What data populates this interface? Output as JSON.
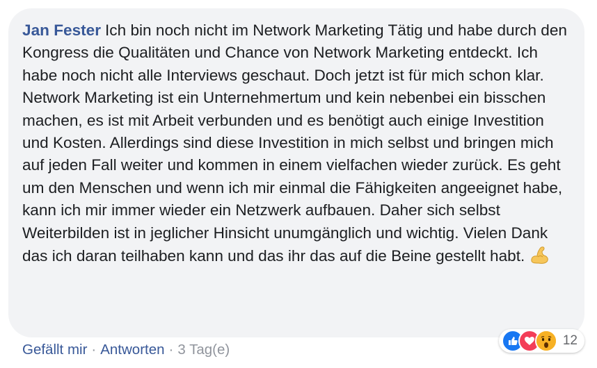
{
  "comment": {
    "author": "Jan Fester",
    "text": "Ich bin noch nicht im Network Marketing Tätig und habe durch den Kongress die Qualitäten und Chance von Network Marketing entdeckt. Ich habe noch nicht alle Interviews geschaut. Doch jetzt ist für mich schon klar. Network Marketing ist ein Unternehmertum und kein nebenbei ein bisschen machen, es ist mit Arbeit verbunden und es benötigt auch einige Investition und Kosten. Allerdings sind diese Investition in mich selbst und bringen mich auf jeden Fall weiter und kommen in einem vielfachen wieder zurück. Es geht um den Menschen und wenn ich mir einmal die Fähigkeiten angeeignet habe, kann ich mir immer wieder ein Netzwerk aufbauen. Daher sich selbst Weiterbilden ist in jeglicher Hinsicht unumgänglich und wichtig. Vielen Dank das ich daran teilhaben kann und das ihr das auf die Beine gestellt habt.",
    "emoji_icon": "flexed-biceps-emoji"
  },
  "reactions": {
    "icons": [
      "like-icon",
      "love-icon",
      "wow-icon"
    ],
    "count": "12"
  },
  "actions": {
    "like_label": "Gefällt mir",
    "reply_label": "Antworten",
    "separator": "·",
    "timestamp": "3 Tag(e)"
  },
  "colors": {
    "author": "#385898",
    "bubble": "#f2f3f5",
    "like": "#1877f2",
    "love": "#f33e58",
    "wow": "#f7b125"
  }
}
